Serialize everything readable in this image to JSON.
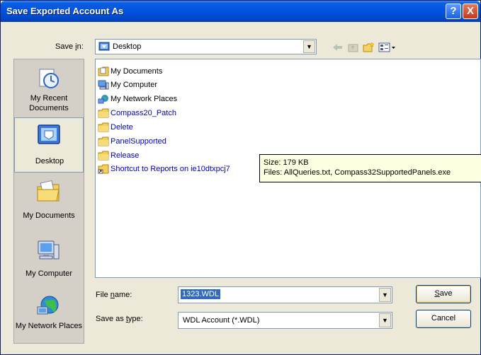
{
  "window": {
    "title": "Save Exported Account As",
    "help_label": "?",
    "close_label": "X"
  },
  "save_in": {
    "label_pre": "Save ",
    "label_u": "i",
    "label_post": "n:",
    "value": "Desktop"
  },
  "places": [
    {
      "label": "My Recent Documents",
      "icon": "recent-documents-icon"
    },
    {
      "label": "Desktop",
      "icon": "desktop-icon"
    },
    {
      "label": "My Documents",
      "icon": "my-documents-icon"
    },
    {
      "label": "My Computer",
      "icon": "my-computer-icon"
    },
    {
      "label": "My Network Places",
      "icon": "network-places-icon"
    }
  ],
  "files": [
    {
      "name": "My Documents",
      "icon": "my-documents-icon",
      "kind": "system"
    },
    {
      "name": "My Computer",
      "icon": "my-computer-icon",
      "kind": "system"
    },
    {
      "name": "My Network Places",
      "icon": "network-places-icon",
      "kind": "system"
    },
    {
      "name": "Compass20_Patch",
      "icon": "folder-icon",
      "kind": "folder"
    },
    {
      "name": "Delete",
      "icon": "folder-icon",
      "kind": "folder"
    },
    {
      "name": "PanelSupported",
      "icon": "folder-icon",
      "kind": "folder"
    },
    {
      "name": "Release",
      "icon": "folder-icon",
      "kind": "folder"
    },
    {
      "name": "Shortcut to Reports on ie10dtxpcj7",
      "icon": "shortcut-folder-icon",
      "kind": "folder"
    }
  ],
  "tooltip": {
    "size": "Size: 179 KB",
    "files": "Files: AllQueries.txt, Compass32SupportedPanels.exe"
  },
  "file_name": {
    "label_pre": "File ",
    "label_u": "n",
    "label_post": "ame:",
    "value": "1323.WDL"
  },
  "save_as_type": {
    "label_pre": "Save as ",
    "label_u": "t",
    "label_post": "ype:",
    "value": "WDL Account (*.WDL)"
  },
  "buttons": {
    "save_u": "S",
    "save_rest": "ave",
    "cancel": "Cancel"
  },
  "colors": {
    "titlebar": "#0054e3",
    "dialog_bg": "#ece9d8",
    "link_blue": "#0000cc",
    "selection": "#316ac5",
    "tooltip_bg": "#ffffe1"
  }
}
